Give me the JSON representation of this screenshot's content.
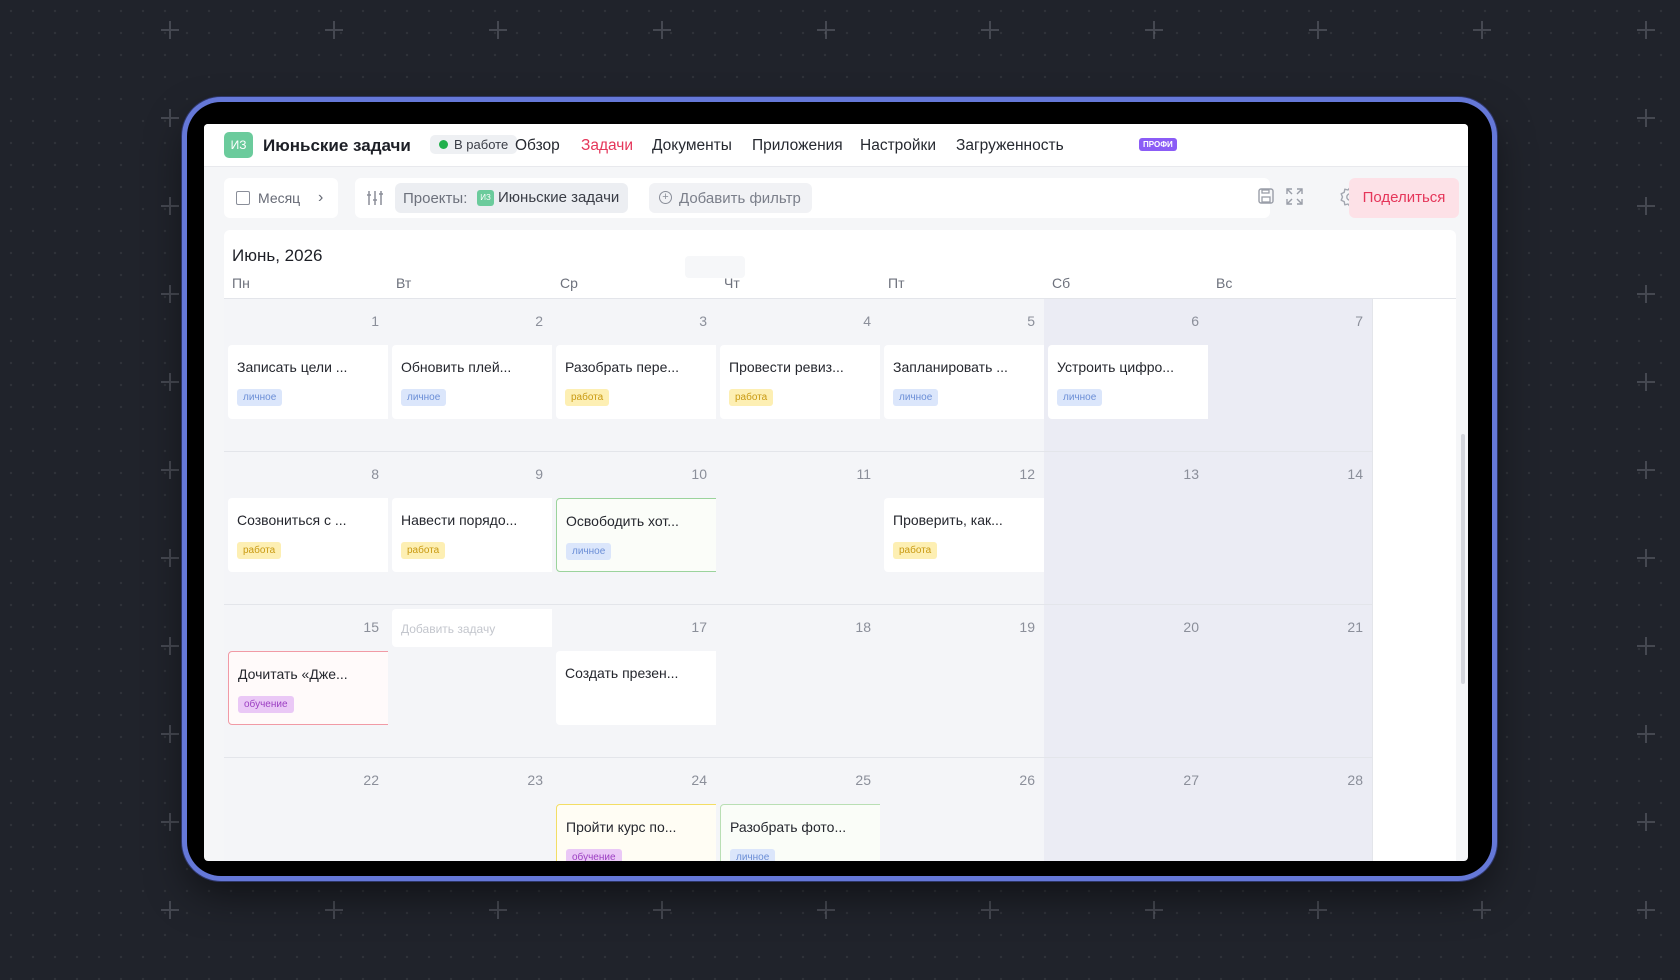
{
  "header": {
    "project_initials": "ИЗ",
    "project_name": "Июньские задачи",
    "status": "В работе",
    "tabs": [
      "Обзор",
      "Задачи",
      "Документы",
      "Приложения",
      "Настройки",
      "Загруженность"
    ],
    "active_tab": "Задачи",
    "pro_badge": "ПРОФИ"
  },
  "toolbar": {
    "view_label": "Месяц",
    "filter_key": "Проекты:",
    "filter_value_initials": "ИЗ",
    "filter_value": "Июньские задачи",
    "add_filter": "Добавить фильтр",
    "share_label": "Поделиться"
  },
  "calendar": {
    "month_title": "Июнь, 2026",
    "weekdays": [
      "Пн",
      "Вт",
      "Ср",
      "Чт",
      "Пт",
      "Сб",
      "Вс"
    ],
    "add_task_placeholder": "Добавить задачу",
    "days": {
      "1": {
        "title": "Записать цели ...",
        "tag": "личное"
      },
      "2": {
        "title": "Обновить плей...",
        "tag": "личное"
      },
      "3": {
        "title": "Разобрать пере...",
        "tag": "работа"
      },
      "4": {
        "title": "Провести ревиз...",
        "tag": "работа"
      },
      "5": {
        "title": "Запланировать ...",
        "tag": "личное"
      },
      "6": {
        "title": "Устроить цифро...",
        "tag": "личное"
      },
      "8": {
        "title": "Созвониться с ...",
        "tag": "работа"
      },
      "9": {
        "title": "Навести порядо...",
        "tag": "работа"
      },
      "10": {
        "title": "Освободить хот...",
        "tag": "личное"
      },
      "12": {
        "title": "Проверить, как...",
        "tag": "работа"
      },
      "15": {
        "title": "Дочитать «Дже...",
        "tag": "обучение"
      },
      "17": {
        "title": "Создать презен...",
        "tag": ""
      },
      "24": {
        "title": "Пройти курс по...",
        "tag": "обучение"
      },
      "25": {
        "title": "Разобрать фото...",
        "tag": "личное"
      }
    }
  },
  "colors": {
    "accent": "#e5365a",
    "device_frame": "#6578d8",
    "tag_personal": "#dbe6fb",
    "tag_work": "#fdefb3",
    "tag_learning": "#eac8f6"
  }
}
